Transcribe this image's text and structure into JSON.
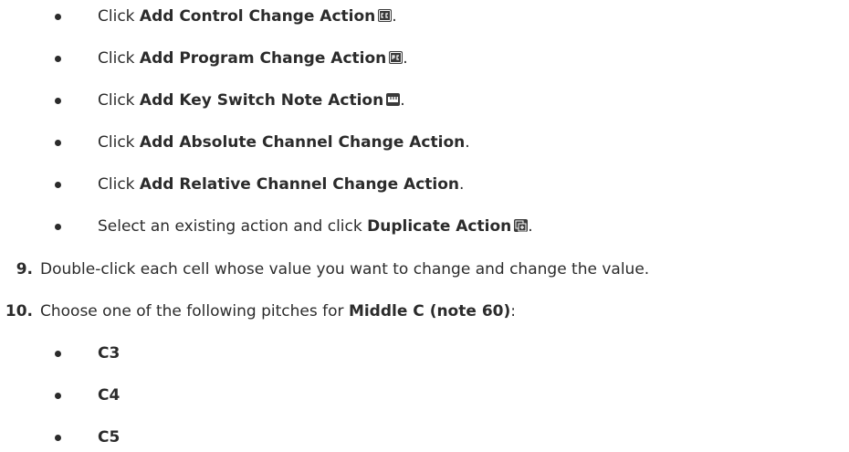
{
  "steps": {
    "bullets_a": [
      {
        "prefix": "Click ",
        "bold": "Add Control Change Action",
        "suffix": ".",
        "icon": "control-change-icon"
      },
      {
        "prefix": "Click ",
        "bold": "Add Program Change Action",
        "suffix": ".",
        "icon": "program-change-icon"
      },
      {
        "prefix": "Click ",
        "bold": "Add Key Switch Note Action",
        "suffix": ".",
        "icon": "key-switch-icon"
      },
      {
        "prefix": "Click ",
        "bold": "Add Absolute Channel Change Action",
        "suffix": "."
      },
      {
        "prefix": "Click ",
        "bold": "Add Relative Channel Change Action",
        "suffix": "."
      },
      {
        "prefix": "Select an existing action and click ",
        "bold": "Duplicate Action",
        "suffix": ".",
        "icon": "duplicate-icon"
      }
    ],
    "step9": {
      "number": "9.",
      "text": "Double-click each cell whose value you want to change and change the value."
    },
    "step10": {
      "number": "10.",
      "prefix": "Choose one of the following pitches for ",
      "bold": "Middle C (note 60)",
      "suffix": ":"
    },
    "pitches": [
      "C3",
      "C4",
      "C5"
    ]
  }
}
